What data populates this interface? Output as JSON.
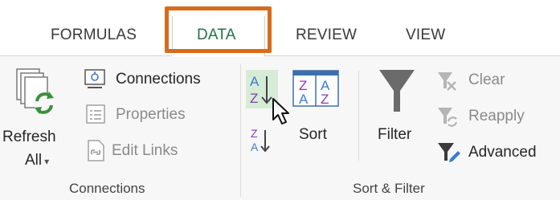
{
  "tabs": [
    {
      "label": "FORMULAS",
      "active": false
    },
    {
      "label": "DATA",
      "active": true
    },
    {
      "label": "REVIEW",
      "active": false
    },
    {
      "label": "VIEW",
      "active": false
    }
  ],
  "connections_group": {
    "label": "Connections",
    "refresh_all": {
      "label_line1": "Refresh",
      "label_line2": "All",
      "caret": "▾"
    },
    "connections": {
      "label": "Connections"
    },
    "properties": {
      "label": "Properties",
      "enabled": false
    },
    "edit_links": {
      "label": "Edit Links",
      "enabled": false
    }
  },
  "sort_filter_group": {
    "label": "Sort & Filter",
    "sort_az": {
      "icon": "sort-a-to-z-icon"
    },
    "sort_za": {
      "icon": "sort-z-to-a-icon"
    },
    "sort": {
      "label": "Sort"
    },
    "filter": {
      "label": "Filter"
    },
    "clear": {
      "label": "Clear",
      "enabled": false
    },
    "reapply": {
      "label": "Reapply",
      "enabled": false
    },
    "advanced": {
      "label": "Advanced",
      "enabled": true
    }
  },
  "colors": {
    "highlight_border": "#d86a1c",
    "active_tab_text": "#217346",
    "hover_fill": "#d6ecd6"
  }
}
